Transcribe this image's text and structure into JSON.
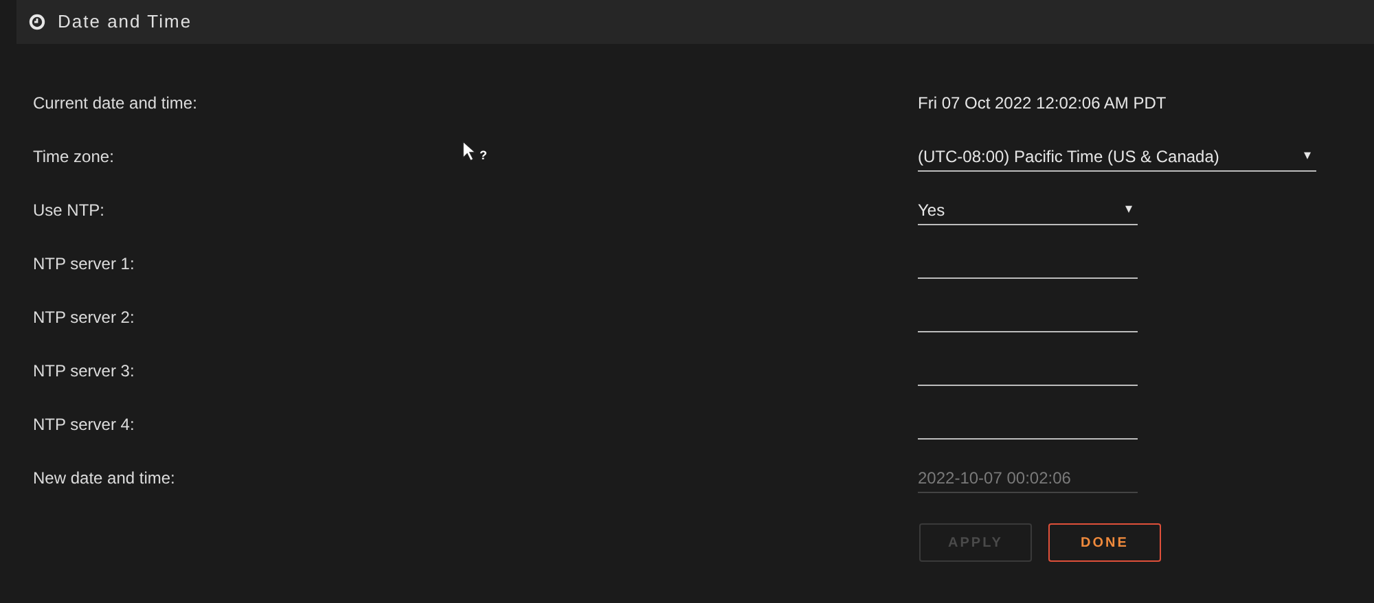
{
  "header": {
    "title": "Date and Time"
  },
  "rows": [
    {
      "label": "Current date and time:",
      "kind": "text",
      "value": "Fri 07 Oct 2022 12:02:06 AM PDT"
    },
    {
      "label": "Time zone:",
      "kind": "select",
      "value": "(UTC-08:00) Pacific Time (US & Canada)",
      "wide": true,
      "arrow": "▾"
    },
    {
      "label": "Use NTP:",
      "kind": "select",
      "value": "Yes",
      "wide": false,
      "arrow": "▾"
    },
    {
      "label": "NTP server 1:",
      "kind": "input",
      "disabled": false
    },
    {
      "label": "NTP server 2:",
      "kind": "input",
      "disabled": false
    },
    {
      "label": "NTP server 3:",
      "kind": "input",
      "disabled": false
    },
    {
      "label": "NTP server 4:",
      "kind": "input",
      "disabled": false
    },
    {
      "label": "New date and time:",
      "kind": "input",
      "value": "2022-10-07 00:02:06",
      "disabled": true
    }
  ],
  "buttons": [
    {
      "label": "APPLY",
      "disabled": true
    },
    {
      "label": "DONE",
      "disabled": false
    }
  ],
  "cursor": {
    "badge": "?"
  }
}
